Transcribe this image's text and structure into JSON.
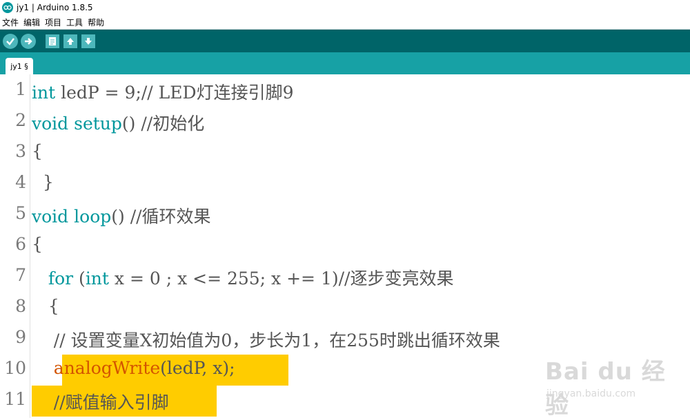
{
  "window": {
    "title": "jy1 | Arduino 1.8.5"
  },
  "menu": [
    "文件",
    "编辑",
    "项目",
    "工具",
    "帮助"
  ],
  "toolbar": {
    "buttons": [
      "verify-icon",
      "upload-icon",
      "new-icon",
      "open-icon",
      "save-icon"
    ]
  },
  "tab": {
    "label": "jy1 §"
  },
  "editor": {
    "line_numbers": [
      "1",
      "2",
      "3",
      "4",
      "5",
      "6",
      "7",
      "8",
      "9",
      "10",
      "11"
    ],
    "lines": [
      {
        "parts": [
          {
            "t": "int",
            "c": "kw"
          },
          {
            "t": " ledP = 9;// LED灯连接引脚9",
            "c": "cm"
          }
        ]
      },
      {
        "parts": [
          {
            "t": "void",
            "c": "kw"
          },
          {
            "t": " ",
            "c": "cm"
          },
          {
            "t": "setup",
            "c": "kw"
          },
          {
            "t": "() //初始化",
            "c": "cm"
          }
        ]
      },
      {
        "parts": [
          {
            "t": "{",
            "c": "cm"
          }
        ]
      },
      {
        "parts": [
          {
            "t": "  }",
            "c": "cm"
          }
        ]
      },
      {
        "parts": [
          {
            "t": "void",
            "c": "kw"
          },
          {
            "t": " ",
            "c": "cm"
          },
          {
            "t": "loop",
            "c": "kw"
          },
          {
            "t": "() //循环效果",
            "c": "cm"
          }
        ]
      },
      {
        "parts": [
          {
            "t": "{",
            "c": "cm"
          }
        ]
      },
      {
        "parts": [
          {
            "t": "   ",
            "c": "cm"
          },
          {
            "t": "for",
            "c": "kw"
          },
          {
            "t": " (",
            "c": "cm"
          },
          {
            "t": "int",
            "c": "kw"
          },
          {
            "t": " x = 0 ; x <= 255; x += 1)//逐步变亮效果",
            "c": "cm"
          }
        ]
      },
      {
        "parts": [
          {
            "t": "   {",
            "c": "cm"
          }
        ]
      },
      {
        "parts": [
          {
            "t": "    // 设置变量X初始值为0，步长为1，在255时跳出循环效果",
            "c": "cm"
          }
        ]
      },
      {
        "parts": [
          {
            "t": "    ",
            "c": "cm"
          },
          {
            "t": "analogWrite",
            "c": "fn"
          },
          {
            "t": "(ledP, x);",
            "c": "cm"
          }
        ]
      },
      {
        "parts": [
          {
            "t": "    //赋值输入引脚",
            "c": "cm"
          }
        ]
      }
    ]
  },
  "watermark": {
    "brand": "Bai du 经验",
    "url": "jingyan.baidu.com"
  },
  "colors": {
    "toolbar": "#006468",
    "tabbar": "#17a1a5",
    "highlight": "#ffcc00"
  }
}
